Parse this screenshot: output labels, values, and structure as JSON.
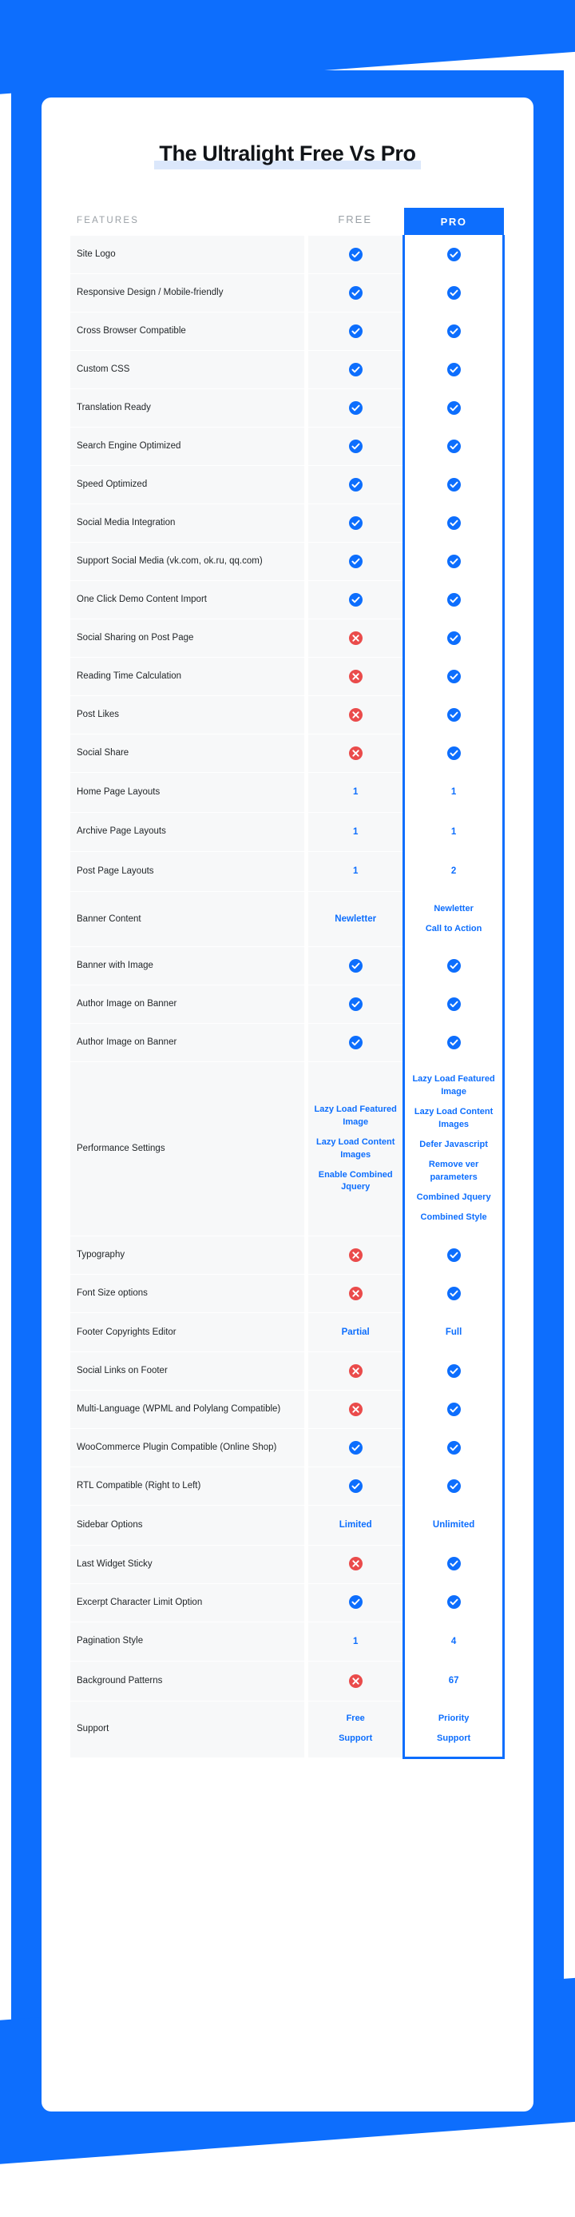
{
  "page": {
    "title": "The Ultralight Free Vs Pro",
    "accent_color": "#0d6efd",
    "yes_color": "#0d6efd",
    "no_color": "#ea4b4b",
    "highlight_color": "#dbe7fb",
    "row_bg": "#f7f8f9"
  },
  "table": {
    "headers": {
      "features": "FEATURES",
      "free": "FREE",
      "pro": "PRO"
    },
    "rows": [
      {
        "feature": "Site Logo",
        "free": {
          "type": "yes"
        },
        "pro": {
          "type": "yes"
        }
      },
      {
        "feature": "Responsive Design / Mobile-friendly",
        "free": {
          "type": "yes"
        },
        "pro": {
          "type": "yes"
        }
      },
      {
        "feature": "Cross Browser Compatible",
        "free": {
          "type": "yes"
        },
        "pro": {
          "type": "yes"
        }
      },
      {
        "feature": "Custom CSS",
        "free": {
          "type": "yes"
        },
        "pro": {
          "type": "yes"
        }
      },
      {
        "feature": "Translation Ready",
        "free": {
          "type": "yes"
        },
        "pro": {
          "type": "yes"
        }
      },
      {
        "feature": "Search Engine Optimized",
        "free": {
          "type": "yes"
        },
        "pro": {
          "type": "yes"
        }
      },
      {
        "feature": "Speed Optimized",
        "free": {
          "type": "yes"
        },
        "pro": {
          "type": "yes"
        }
      },
      {
        "feature": "Social Media Integration",
        "free": {
          "type": "yes"
        },
        "pro": {
          "type": "yes"
        }
      },
      {
        "feature": "Support Social Media (vk.com, ok.ru, qq.com)",
        "free": {
          "type": "yes"
        },
        "pro": {
          "type": "yes"
        }
      },
      {
        "feature": "One Click Demo Content Import",
        "free": {
          "type": "yes"
        },
        "pro": {
          "type": "yes"
        }
      },
      {
        "feature": "Social Sharing on Post Page",
        "free": {
          "type": "no"
        },
        "pro": {
          "type": "yes"
        }
      },
      {
        "feature": "Reading Time Calculation",
        "free": {
          "type": "no"
        },
        "pro": {
          "type": "yes"
        }
      },
      {
        "feature": "Post Likes",
        "free": {
          "type": "no"
        },
        "pro": {
          "type": "yes"
        }
      },
      {
        "feature": "Social Share",
        "free": {
          "type": "no"
        },
        "pro": {
          "type": "yes"
        }
      },
      {
        "feature": "Home Page Layouts",
        "free": {
          "type": "text",
          "value": "1"
        },
        "pro": {
          "type": "text",
          "value": "1"
        }
      },
      {
        "feature": "Archive Page Layouts",
        "free": {
          "type": "text",
          "value": "1"
        },
        "pro": {
          "type": "text",
          "value": "1"
        }
      },
      {
        "feature": "Post Page Layouts",
        "free": {
          "type": "text",
          "value": "1"
        },
        "pro": {
          "type": "text",
          "value": "2"
        }
      },
      {
        "feature": "Banner Content",
        "free": {
          "type": "text",
          "value": "Newletter"
        },
        "pro": {
          "type": "list",
          "items": [
            "Newletter",
            "Call to Action"
          ]
        }
      },
      {
        "feature": "Banner with Image",
        "free": {
          "type": "yes"
        },
        "pro": {
          "type": "yes"
        }
      },
      {
        "feature": "Author Image on Banner",
        "free": {
          "type": "yes"
        },
        "pro": {
          "type": "yes"
        }
      },
      {
        "feature": "Author Image on Banner",
        "free": {
          "type": "yes"
        },
        "pro": {
          "type": "yes"
        }
      },
      {
        "feature": "Performance Settings",
        "free": {
          "type": "list",
          "items": [
            "Lazy Load Featured Image",
            "Lazy Load Content Images",
            "Enable Combined Jquery"
          ]
        },
        "pro": {
          "type": "list",
          "items": [
            "Lazy Load Featured Image",
            "Lazy Load Content Images",
            "Defer Javascript",
            "Remove ver parameters",
            "Combined Jquery",
            "Combined Style"
          ]
        }
      },
      {
        "feature": "Typography",
        "free": {
          "type": "no"
        },
        "pro": {
          "type": "yes"
        }
      },
      {
        "feature": "Font Size options",
        "free": {
          "type": "no"
        },
        "pro": {
          "type": "yes"
        }
      },
      {
        "feature": "Footer Copyrights Editor",
        "free": {
          "type": "text",
          "value": "Partial"
        },
        "pro": {
          "type": "text",
          "value": "Full"
        }
      },
      {
        "feature": "Social Links on Footer",
        "free": {
          "type": "no"
        },
        "pro": {
          "type": "yes"
        }
      },
      {
        "feature": "Multi-Language (WPML and Polylang Compatible)",
        "free": {
          "type": "no"
        },
        "pro": {
          "type": "yes"
        }
      },
      {
        "feature": "WooCommerce Plugin Compatible (Online Shop)",
        "free": {
          "type": "yes"
        },
        "pro": {
          "type": "yes"
        }
      },
      {
        "feature": "RTL Compatible (Right to Left)",
        "free": {
          "type": "yes"
        },
        "pro": {
          "type": "yes"
        }
      },
      {
        "feature": "Sidebar Options",
        "free": {
          "type": "text",
          "value": "Limited"
        },
        "pro": {
          "type": "text",
          "value": "Unlimited"
        }
      },
      {
        "feature": "Last Widget Sticky",
        "free": {
          "type": "no"
        },
        "pro": {
          "type": "yes"
        }
      },
      {
        "feature": "Excerpt Character Limit Option",
        "free": {
          "type": "yes"
        },
        "pro": {
          "type": "yes"
        }
      },
      {
        "feature": "Pagination Style",
        "free": {
          "type": "text",
          "value": "1"
        },
        "pro": {
          "type": "text",
          "value": "4"
        }
      },
      {
        "feature": "Background Patterns",
        "free": {
          "type": "no"
        },
        "pro": {
          "type": "text",
          "value": "67"
        }
      },
      {
        "feature": "Support",
        "free": {
          "type": "list",
          "items": [
            "Free",
            "Support"
          ]
        },
        "pro": {
          "type": "list",
          "items": [
            "Priority",
            "Support"
          ]
        }
      }
    ]
  },
  "icons": {
    "yes": "check-circle-icon",
    "no": "times-circle-icon"
  }
}
